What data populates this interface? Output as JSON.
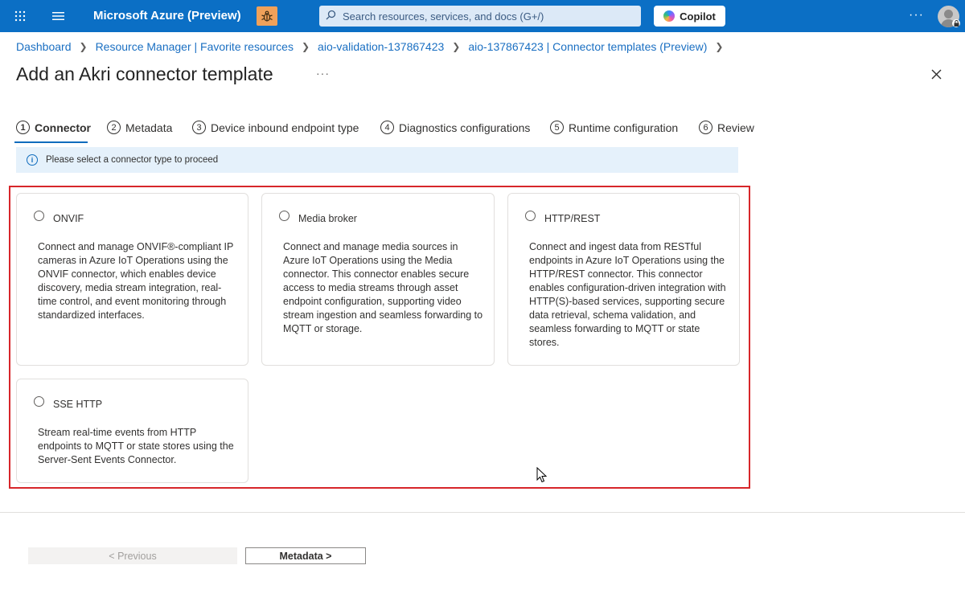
{
  "topbar": {
    "brand": "Microsoft Azure (Preview)",
    "search_placeholder": "Search resources, services, and docs (G+/)",
    "copilot_label": "Copilot",
    "more_label": "···"
  },
  "breadcrumb": [
    "Dashboard",
    "Resource Manager | Favorite resources",
    "aio-validation-137867423",
    "aio-137867423 | Connector templates (Preview)"
  ],
  "page": {
    "title": "Add an Akri connector template",
    "more_label": "···"
  },
  "steps": [
    {
      "num": "1",
      "label": "Connector",
      "active": true
    },
    {
      "num": "2",
      "label": "Metadata",
      "active": false
    },
    {
      "num": "3",
      "label": "Device inbound endpoint type",
      "active": false
    },
    {
      "num": "4",
      "label": "Diagnostics configurations",
      "active": false
    },
    {
      "num": "5",
      "label": "Runtime configuration",
      "active": false
    },
    {
      "num": "6",
      "label": "Review",
      "active": false
    }
  ],
  "info": {
    "message": "Please select a connector type to proceed"
  },
  "connectors": [
    {
      "label": "ONVIF",
      "description": "Connect and manage ONVIF®-compliant IP cameras in Azure IoT Operations using the ONVIF connector, which enables device discovery, media stream integration, real-time control, and event monitoring through standardized interfaces.",
      "selected": false
    },
    {
      "label": "Media broker",
      "description": "Connect and manage media sources in Azure IoT Operations using the Media connector. This connector enables secure access to media streams through asset endpoint configuration, supporting video stream ingestion and seamless forwarding to MQTT or storage.",
      "selected": false
    },
    {
      "label": "HTTP/REST",
      "description": "Connect and ingest data from RESTful endpoints in Azure IoT Operations using the HTTP/REST connector. This connector enables configuration-driven integration with HTTP(S)-based services, supporting secure data retrieval, schema validation, and seamless forwarding to MQTT or state stores.",
      "selected": false
    },
    {
      "label": "SSE HTTP",
      "description": "Stream real-time events from HTTP endpoints to MQTT or state stores using the Server-Sent Events Connector.",
      "selected": false
    }
  ],
  "footer": {
    "previous_label": "< Previous",
    "next_label": "Metadata >"
  },
  "colors": {
    "topbar": "#0b6fc5",
    "accent": "#0f6cbd",
    "highlight_border": "#d7262a",
    "info_bg": "#e5f1fb"
  }
}
